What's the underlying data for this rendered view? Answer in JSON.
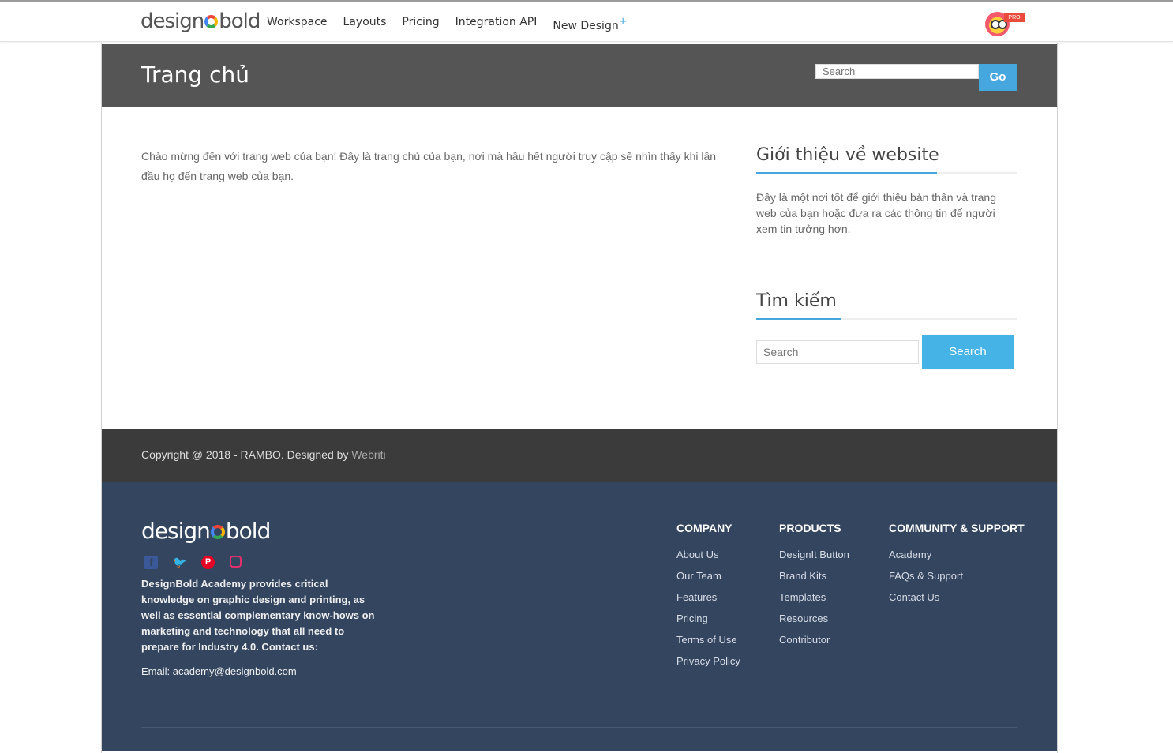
{
  "topbar": {
    "logo": {
      "pre": "design",
      "post": "bold"
    },
    "nav": [
      "Workspace",
      "Layouts",
      "Pricing",
      "Integration API",
      "New Design"
    ],
    "new_design_plus": "+",
    "pro_badge": "PRO"
  },
  "banner": {
    "title": "Trang chủ",
    "search_placeholder": "Search",
    "go_label": "Go"
  },
  "main": {
    "intro": "Chào mừng đến với trang web của bạn! Đây là trang chủ của bạn, nơi mà hầu hết người truy cập sẽ nhìn thấy khi lần đầu họ đến trang web của bạn."
  },
  "sidebar": {
    "about_title": "Giới thiệu về website",
    "about_text": "Đây là một nơi tốt để giới thiệu bản thân và trang web của bạn hoặc đưa ra các thông tin để người xem tin tưởng hơn.",
    "search_title": "Tìm kiếm",
    "search_placeholder": "Search",
    "search_button": "Search"
  },
  "copyright": {
    "text": "Copyright @ 2018 - RAMBO. Designed by ",
    "link": "Webriti"
  },
  "footer": {
    "logo": {
      "pre": "design",
      "post": "bold"
    },
    "about": "DesignBold Academy provides critical knowledge on graphic design and printing, as well as essential complementary know-hows on marketing and technology that all need to prepare for Industry 4.0. Contact us:",
    "email": "Email: academy@designbold.com",
    "company": {
      "heading": "COMPANY",
      "links": [
        "About Us",
        "Our Team",
        "Features",
        "Pricing",
        "Terms of Use",
        "Privacy Policy"
      ]
    },
    "products": {
      "heading": "PRODUCTS",
      "links": [
        "DesignIt Button",
        "Brand Kits",
        "Templates",
        "Resources",
        "Contributor"
      ]
    },
    "community": {
      "heading": "COMMUNITY & SUPPORT",
      "links": [
        "Academy",
        "FAQs & Support",
        "Contact Us"
      ]
    }
  },
  "colors": {
    "accent": "#45a7dd",
    "banner": "#555556",
    "footer": "#344560",
    "copyright_bar": "#3b3b3c"
  }
}
